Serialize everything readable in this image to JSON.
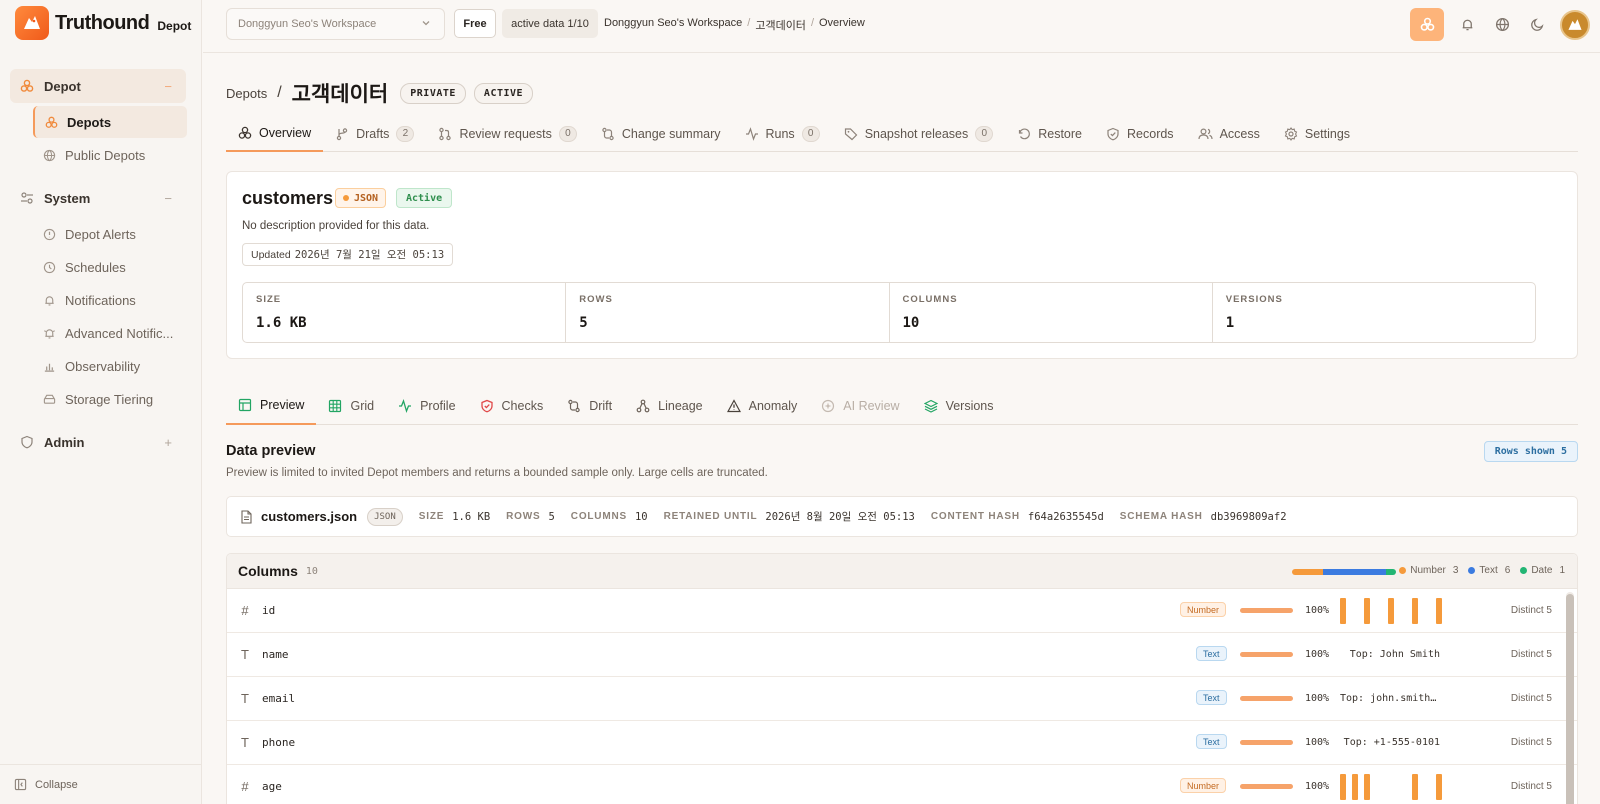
{
  "brand": {
    "name": "Truthound",
    "sub": "Depot"
  },
  "sidebar": {
    "sections": [
      {
        "label": "Depot",
        "toggle": "−"
      },
      {
        "label": "System",
        "toggle": "−"
      },
      {
        "label": "Admin",
        "toggle": "+"
      }
    ],
    "depot_items": [
      {
        "label": "Depots"
      },
      {
        "label": "Public Depots"
      }
    ],
    "system_items": [
      {
        "label": "Depot Alerts"
      },
      {
        "label": "Schedules"
      },
      {
        "label": "Notifications"
      },
      {
        "label": "Advanced Notific..."
      },
      {
        "label": "Observability"
      },
      {
        "label": "Storage Tiering"
      }
    ],
    "collapse_label": "Collapse"
  },
  "topbar": {
    "workspace": "Donggyun Seo's Workspace",
    "plan": "Free",
    "active_data": "active data 1/10",
    "breadcrumb": [
      "Donggyun Seo's Workspace",
      "고객데이터",
      "Overview"
    ]
  },
  "page": {
    "depots_link": "Depots",
    "title": "고객데이터",
    "visibility": "PRIVATE",
    "status": "ACTIVE"
  },
  "tabs": [
    {
      "label": "Overview",
      "count": null
    },
    {
      "label": "Drafts",
      "count": "2"
    },
    {
      "label": "Review requests",
      "count": "0"
    },
    {
      "label": "Change summary",
      "count": null
    },
    {
      "label": "Runs",
      "count": "0"
    },
    {
      "label": "Snapshot releases",
      "count": "0"
    },
    {
      "label": "Restore",
      "count": null
    },
    {
      "label": "Records",
      "count": null
    },
    {
      "label": "Access",
      "count": null
    },
    {
      "label": "Settings",
      "count": null
    }
  ],
  "dataset": {
    "name": "customers",
    "format": "JSON",
    "state": "Active",
    "description": "No description provided for this data.",
    "updated_label": "Updated",
    "updated_value": "2026년 7월 21일 오전 05:13",
    "stats": [
      {
        "label": "SIZE",
        "value": "1.6 KB"
      },
      {
        "label": "ROWS",
        "value": "5"
      },
      {
        "label": "COLUMNS",
        "value": "10"
      },
      {
        "label": "VERSIONS",
        "value": "1"
      }
    ]
  },
  "subtabs": [
    {
      "label": "Preview"
    },
    {
      "label": "Grid"
    },
    {
      "label": "Profile"
    },
    {
      "label": "Checks"
    },
    {
      "label": "Drift"
    },
    {
      "label": "Lineage"
    },
    {
      "label": "Anomaly"
    },
    {
      "label": "AI Review"
    },
    {
      "label": "Versions"
    }
  ],
  "preview": {
    "title": "Data preview",
    "description": "Preview is limited to invited Depot members and returns a bounded sample only. Large cells are truncated.",
    "rows_shown": "Rows shown 5"
  },
  "file": {
    "name": "customers.json",
    "type": "JSON",
    "fields": [
      {
        "k": "SIZE",
        "v": "1.6 KB"
      },
      {
        "k": "ROWS",
        "v": "5"
      },
      {
        "k": "COLUMNS",
        "v": "10"
      },
      {
        "k": "RETAINED UNTIL",
        "v": "2026년 8월 20일 오전 05:13"
      },
      {
        "k": "CONTENT HASH",
        "v": "f64a2635545d"
      },
      {
        "k": "SCHEMA HASH",
        "v": "db3969809af2"
      }
    ]
  },
  "columns": {
    "title": "Columns",
    "count": "10",
    "type_mix": [
      {
        "label": "Number",
        "count": "3",
        "n": 3,
        "color": "#f59a3b"
      },
      {
        "label": "Text",
        "count": "6",
        "n": 6,
        "color": "#3b7be0"
      },
      {
        "label": "Date",
        "count": "1",
        "n": 1,
        "color": "#22b573"
      }
    ],
    "rows": [
      {
        "icon": "#",
        "name": "id",
        "type": "Number",
        "kind": "num",
        "completeness": "100%",
        "fill": 1.0,
        "top": "",
        "hist": [
          1,
          0,
          1,
          0,
          1,
          0,
          1,
          0,
          1
        ],
        "distinct": "Distinct 5"
      },
      {
        "icon": "T",
        "name": "name",
        "type": "Text",
        "kind": "txt",
        "completeness": "100%",
        "fill": 1.0,
        "top": "Top: John Smith",
        "hist": null,
        "distinct": "Distinct 5"
      },
      {
        "icon": "T",
        "name": "email",
        "type": "Text",
        "kind": "txt",
        "completeness": "100%",
        "fill": 1.0,
        "top": "Top: john.smith@…",
        "hist": null,
        "distinct": "Distinct 5"
      },
      {
        "icon": "T",
        "name": "phone",
        "type": "Text",
        "kind": "txt",
        "completeness": "100%",
        "fill": 1.0,
        "top": "Top: +1-555-0101",
        "hist": null,
        "distinct": "Distinct 5"
      },
      {
        "icon": "#",
        "name": "age",
        "type": "Number",
        "kind": "num",
        "completeness": "100%",
        "fill": 1.0,
        "top": "",
        "hist": [
          1,
          1,
          1,
          0,
          0,
          0,
          1,
          0,
          1
        ],
        "distinct": "Distinct 5"
      }
    ]
  },
  "colors": {
    "accent": "#f59a5b",
    "accent_bg": "#fdb47a"
  }
}
